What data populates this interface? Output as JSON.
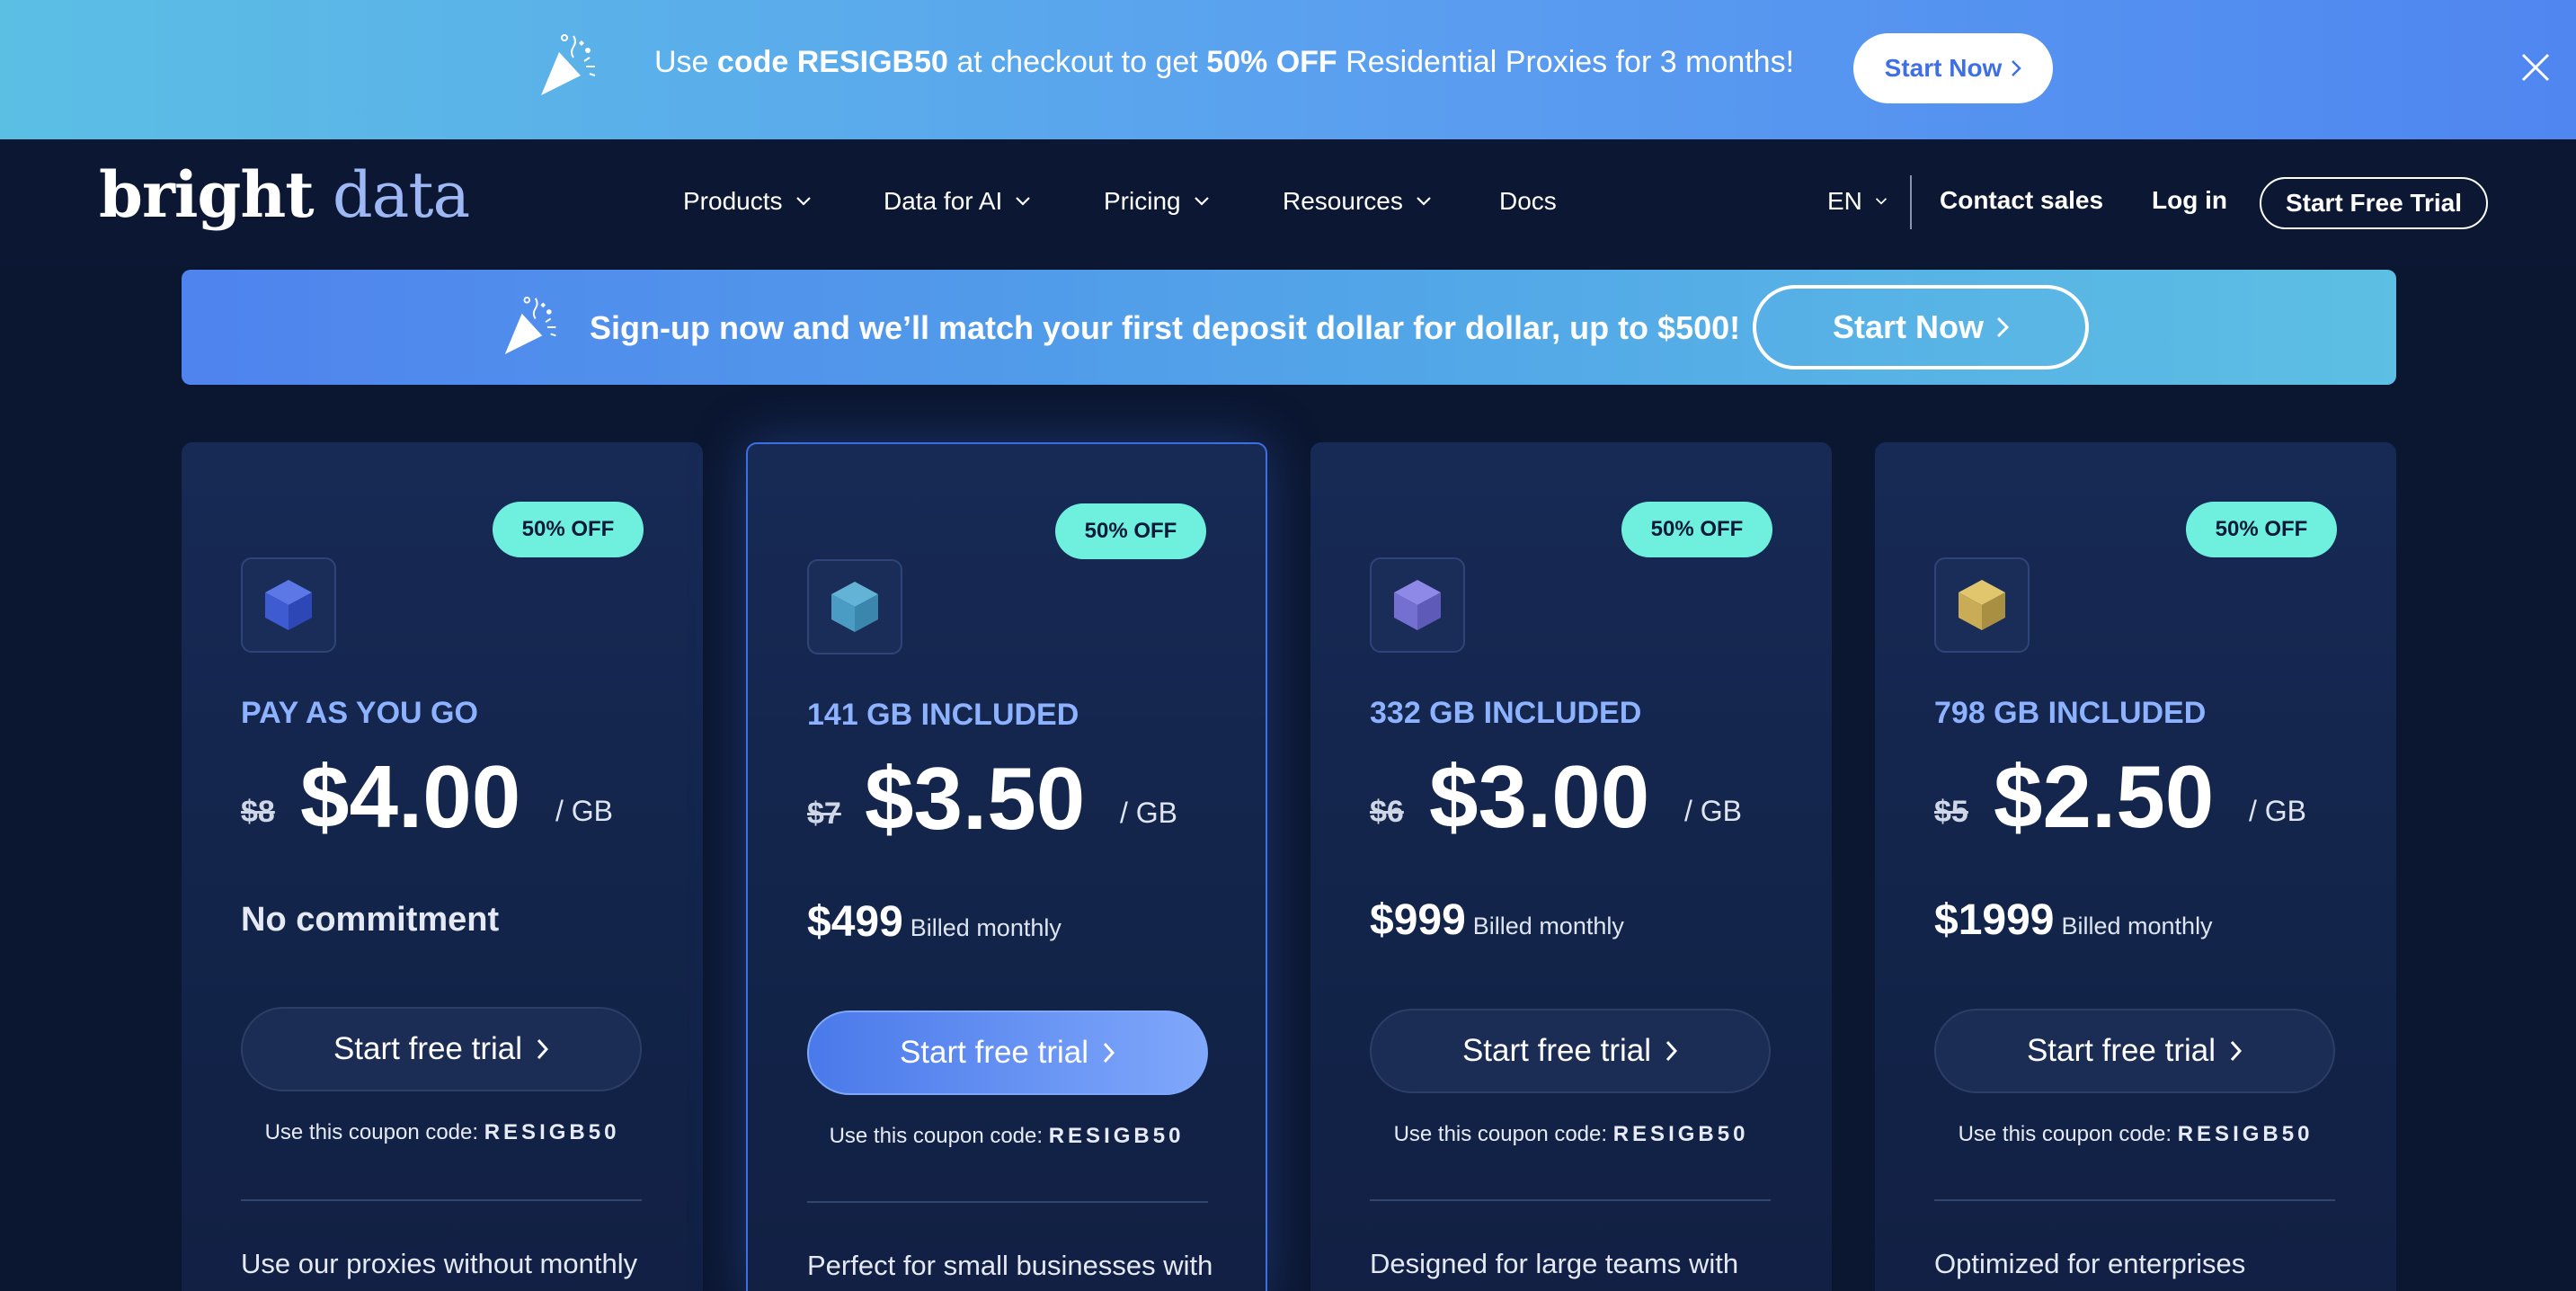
{
  "promo_bar": {
    "text_1": "Use ",
    "code_label": "code RESIGB50",
    "text_2": " at checkout to get ",
    "discount": "50% OFF",
    "text_3": " Residential Proxies for 3 months!",
    "button_label": "Start Now"
  },
  "nav": {
    "logo_word_1": "bright",
    "logo_word_2": "data",
    "items": [
      {
        "label": "Products"
      },
      {
        "label": "Data for AI"
      },
      {
        "label": "Pricing"
      },
      {
        "label": "Resources"
      },
      {
        "label": "Docs"
      }
    ],
    "language": "EN",
    "contact_sales": "Contact sales",
    "login": "Log in",
    "start_trial": "Start Free Trial"
  },
  "deposit_banner": {
    "text": "Sign-up now and we’ll match your first deposit dollar for dollar, up to $500!",
    "button_label": "Start Now"
  },
  "colors": {
    "accent_blue": "#4f83ee",
    "badge_teal": "#6ff0de",
    "plan_name_blue": "#8db2ff",
    "background": "#0b1630"
  },
  "plans": [
    {
      "badge": "50% OFF",
      "icon": "cube-blue-icon",
      "name": "PAY AS YOU GO",
      "old_price": "$8",
      "price": "$4.00",
      "unit": "/ GB",
      "commitment": "No commitment",
      "cta": "Start free trial",
      "coupon_prefix": "Use this coupon code: ",
      "coupon_code": "RESIGB50",
      "description": "Use our proxies without monthly"
    },
    {
      "badge": "50% OFF",
      "icon": "cube-teal-icon",
      "name": "141 GB INCLUDED",
      "old_price": "$7",
      "price": "$3.50",
      "unit": "/ GB",
      "billed_amount": "$499",
      "billed_label": "Billed monthly",
      "cta": "Start free trial",
      "coupon_prefix": "Use this coupon code: ",
      "coupon_code": "RESIGB50",
      "description": "Perfect for small businesses with"
    },
    {
      "badge": "50% OFF",
      "icon": "cube-purple-icon",
      "name": "332 GB INCLUDED",
      "old_price": "$6",
      "price": "$3.00",
      "unit": "/ GB",
      "billed_amount": "$999",
      "billed_label": "Billed monthly",
      "cta": "Start free trial",
      "coupon_prefix": "Use this coupon code: ",
      "coupon_code": "RESIGB50",
      "description": "Designed for large teams with"
    },
    {
      "badge": "50% OFF",
      "icon": "cube-gold-icon",
      "name": "798 GB INCLUDED",
      "old_price": "$5",
      "price": "$2.50",
      "unit": "/ GB",
      "billed_amount": "$1999",
      "billed_label": "Billed monthly",
      "cta": "Start free trial",
      "coupon_prefix": "Use this coupon code: ",
      "coupon_code": "RESIGB50",
      "description": "Optimized for enterprises"
    }
  ]
}
